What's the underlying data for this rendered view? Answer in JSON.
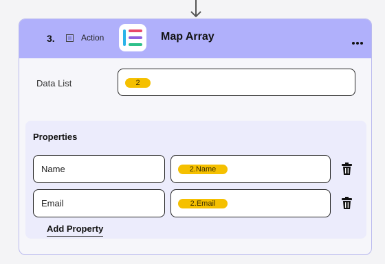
{
  "step": {
    "number": "3.",
    "type_label": "Action",
    "title": "Map Array",
    "app_icon": "list-app-icon"
  },
  "data_list": {
    "label": "Data List",
    "value": "2"
  },
  "properties": {
    "heading": "Properties",
    "rows": [
      {
        "name": "Name",
        "value": "2.Name"
      },
      {
        "name": "Email",
        "value": "2.Email"
      }
    ],
    "add_label": "Add Property"
  },
  "colors": {
    "header_bg": "#b0b0fb",
    "pill_bg": "#f5c000",
    "panel_bg": "#ececfc"
  }
}
